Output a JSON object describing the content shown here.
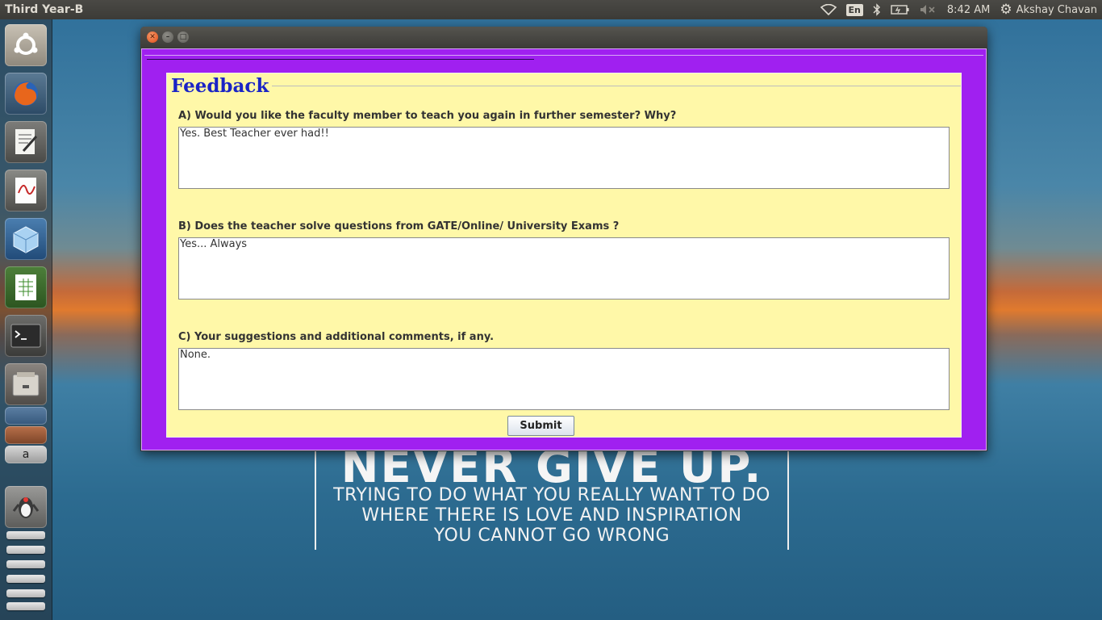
{
  "top_panel": {
    "app_title": "Third Year-B",
    "lang": "En",
    "time": "8:42 AM",
    "user": "Akshay Chavan"
  },
  "launcher": {
    "icons": [
      "ubuntu-icon",
      "firefox-icon",
      "text-editor-icon",
      "document-viewer-icon",
      "virtualbox-icon",
      "spreadsheet-icon",
      "terminal-icon",
      "files-icon",
      "writer-icon",
      "impress-icon",
      "amazon-icon",
      "java-icon"
    ]
  },
  "wallpaper": {
    "headline": "NEVER GIVE UP.",
    "lines": [
      "TRYING TO DO WHAT YOU REALLY WANT TO DO",
      "WHERE THERE IS LOVE AND INSPIRATION",
      "YOU CANNOT GO WRONG"
    ]
  },
  "form": {
    "heading": "Feedback",
    "questions": [
      {
        "label": "A)  Would you like the faculty member to teach you again in further semester?  Why?",
        "answer": "Yes. Best Teacher ever had!!"
      },
      {
        "label": "B)  Does the teacher solve questions from GATE/Online/ University Exams  ?",
        "answer": "Yes... Always"
      },
      {
        "label": "C) Your suggestions and additional comments, if any.",
        "answer": "None."
      }
    ],
    "submit_label": "Submit"
  },
  "colors": {
    "frame": "#a020f0",
    "panel": "#fff8a8",
    "heading": "#1a24c6"
  }
}
